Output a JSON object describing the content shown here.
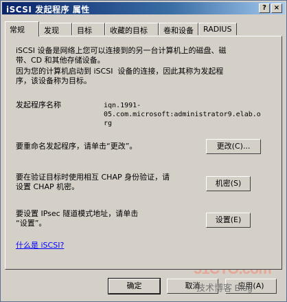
{
  "window": {
    "title": "iSCSI 发起程序 属性"
  },
  "titlebar_buttons": {
    "help": "?",
    "close": "×"
  },
  "tabs": [
    {
      "label": "常规"
    },
    {
      "label": "发现"
    },
    {
      "label": "目标"
    },
    {
      "label": "收藏的目标"
    },
    {
      "label": "卷和设备"
    },
    {
      "label": "RADIUS"
    }
  ],
  "general": {
    "intro_line1": "iSCSI 设备是网络上您可以连接到的另一台计算机上的磁盘、磁",
    "intro_line2": "带、CD 和其他存储设备。",
    "intro_line3": "因为您的计算机启动到 iSCSI  设备的连接，因此其称为发起程",
    "intro_line4": "序，该设备称为目标。",
    "initiator_label": "发起程序名称",
    "initiator_name_line1": "iqn.1991-",
    "initiator_name_line2": "05.com.microsoft:administrator9.elab.o",
    "initiator_name_line3": "rg",
    "rename_text": "要重命名发起程序，请单击“更改”。",
    "rename_button": "更改(C)...",
    "chap_line1": "要在验证目标时使用相互 CHAP 身份验证，请",
    "chap_line2": "设置 CHAP 机密。",
    "chap_button": "机密(S)",
    "ipsec_line1": "要设置 IPsec 隧道模式地址，请单击",
    "ipsec_line2": "“设置”。",
    "ipsec_button": "设置(E)",
    "what_is_link": "什么是 iSCSI?"
  },
  "footer": {
    "ok": "确定",
    "cancel": "取消",
    "apply": "应用(A)"
  },
  "watermark": {
    "line1": "51CTO.com",
    "line2": "技术博客 Blog"
  }
}
